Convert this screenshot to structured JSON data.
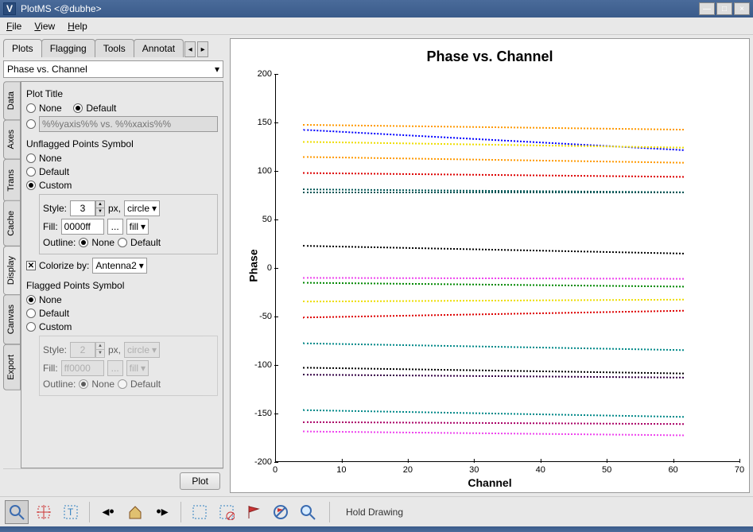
{
  "window": {
    "title": "PlotMS <@dubhe>"
  },
  "menu": {
    "file": "File",
    "view": "View",
    "help": "Help"
  },
  "top_tabs": {
    "plots": "Plots",
    "flagging": "Flagging",
    "tools": "Tools",
    "annotate": "Annotat"
  },
  "plot_select": "Phase vs. Channel",
  "side_tabs": {
    "data": "Data",
    "axes": "Axes",
    "trans": "Trans",
    "cache": "Cache",
    "display": "Display",
    "canvas": "Canvas",
    "export": "Export"
  },
  "plot_title": {
    "label": "Plot Title",
    "none": "None",
    "default": "Default",
    "custom_placeholder": "%%yaxis%% vs. %%xaxis%%"
  },
  "unflagged": {
    "label": "Unflagged Points Symbol",
    "none": "None",
    "default": "Default",
    "custom": "Custom",
    "style_label": "Style:",
    "style_value": "3",
    "px": "px,",
    "shape": "circle",
    "fill_label": "Fill:",
    "fill_value": "0000ff",
    "ellipsis": "...",
    "fill_mode": "fill",
    "outline_label": "Outline:",
    "outline_none": "None",
    "outline_default": "Default"
  },
  "colorize": {
    "label": "Colorize by:",
    "value": "Antenna2"
  },
  "flagged": {
    "label": "Flagged Points Symbol",
    "none": "None",
    "default": "Default",
    "custom": "Custom",
    "style_label": "Style:",
    "style_value": "2",
    "px": "px,",
    "shape": "circle",
    "fill_label": "Fill:",
    "fill_value": "ff0000",
    "ellipsis": "...",
    "fill_mode": "fill",
    "outline_label": "Outline:",
    "outline_none": "None",
    "outline_default": "Default"
  },
  "plot_button": "Plot",
  "status": "Hold Drawing",
  "chart_data": {
    "type": "scatter",
    "title": "Phase vs. Channel",
    "xlabel": "Channel",
    "ylabel": "Phase",
    "xlim": [
      0,
      70
    ],
    "ylim": [
      -200,
      200
    ],
    "x_ticks": [
      0,
      10,
      20,
      30,
      40,
      50,
      60,
      70
    ],
    "y_ticks": [
      -200,
      -150,
      -100,
      -50,
      0,
      50,
      100,
      150,
      200
    ],
    "x_range": [
      3,
      60
    ],
    "series": [
      {
        "color": "#ff9900",
        "y_start": 148,
        "y_end": 143
      },
      {
        "color": "#0000ff",
        "y_start": 143,
        "y_end": 122
      },
      {
        "color": "#eedd00",
        "y_start": 131,
        "y_end": 125
      },
      {
        "color": "#ff9900",
        "y_start": 115,
        "y_end": 109
      },
      {
        "color": "#dd0000",
        "y_start": 99,
        "y_end": 95
      },
      {
        "color": "#005555",
        "y_start": 82,
        "y_end": 79
      },
      {
        "color": "#005555",
        "y_start": 79,
        "y_end": 79
      },
      {
        "color": "#000000",
        "y_start": 24,
        "y_end": 16
      },
      {
        "color": "#ee44ee",
        "y_start": -9,
        "y_end": -10
      },
      {
        "color": "#008800",
        "y_start": -14,
        "y_end": -18
      },
      {
        "color": "#eedd00",
        "y_start": -34,
        "y_end": -32
      },
      {
        "color": "#dd0000",
        "y_start": -50,
        "y_end": -43
      },
      {
        "color": "#008888",
        "y_start": -77,
        "y_end": -84
      },
      {
        "color": "#000000",
        "y_start": -102,
        "y_end": -108
      },
      {
        "color": "#330044",
        "y_start": -109,
        "y_end": -112
      },
      {
        "color": "#008888",
        "y_start": -146,
        "y_end": -153
      },
      {
        "color": "#aa0066",
        "y_start": -158,
        "y_end": -160
      },
      {
        "color": "#ee44ee",
        "y_start": -168,
        "y_end": -172
      }
    ]
  }
}
